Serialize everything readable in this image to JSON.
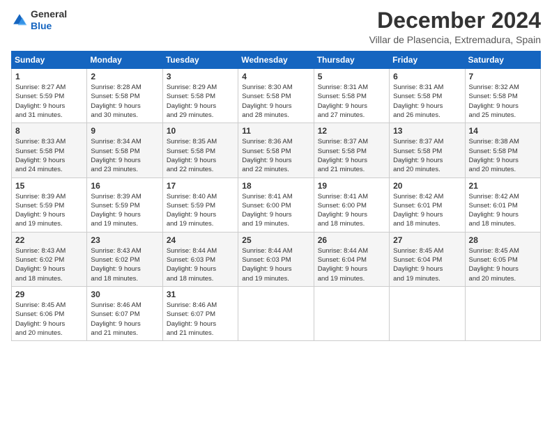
{
  "logo": {
    "line1": "General",
    "line2": "Blue"
  },
  "title": "December 2024",
  "subtitle": "Villar de Plasencia, Extremadura, Spain",
  "calendar": {
    "headers": [
      "Sunday",
      "Monday",
      "Tuesday",
      "Wednesday",
      "Thursday",
      "Friday",
      "Saturday"
    ],
    "weeks": [
      [
        {
          "day": "1",
          "info": "Sunrise: 8:27 AM\nSunset: 5:59 PM\nDaylight: 9 hours\nand 31 minutes."
        },
        {
          "day": "2",
          "info": "Sunrise: 8:28 AM\nSunset: 5:58 PM\nDaylight: 9 hours\nand 30 minutes."
        },
        {
          "day": "3",
          "info": "Sunrise: 8:29 AM\nSunset: 5:58 PM\nDaylight: 9 hours\nand 29 minutes."
        },
        {
          "day": "4",
          "info": "Sunrise: 8:30 AM\nSunset: 5:58 PM\nDaylight: 9 hours\nand 28 minutes."
        },
        {
          "day": "5",
          "info": "Sunrise: 8:31 AM\nSunset: 5:58 PM\nDaylight: 9 hours\nand 27 minutes."
        },
        {
          "day": "6",
          "info": "Sunrise: 8:31 AM\nSunset: 5:58 PM\nDaylight: 9 hours\nand 26 minutes."
        },
        {
          "day": "7",
          "info": "Sunrise: 8:32 AM\nSunset: 5:58 PM\nDaylight: 9 hours\nand 25 minutes."
        }
      ],
      [
        {
          "day": "8",
          "info": "Sunrise: 8:33 AM\nSunset: 5:58 PM\nDaylight: 9 hours\nand 24 minutes."
        },
        {
          "day": "9",
          "info": "Sunrise: 8:34 AM\nSunset: 5:58 PM\nDaylight: 9 hours\nand 23 minutes."
        },
        {
          "day": "10",
          "info": "Sunrise: 8:35 AM\nSunset: 5:58 PM\nDaylight: 9 hours\nand 22 minutes."
        },
        {
          "day": "11",
          "info": "Sunrise: 8:36 AM\nSunset: 5:58 PM\nDaylight: 9 hours\nand 22 minutes."
        },
        {
          "day": "12",
          "info": "Sunrise: 8:37 AM\nSunset: 5:58 PM\nDaylight: 9 hours\nand 21 minutes."
        },
        {
          "day": "13",
          "info": "Sunrise: 8:37 AM\nSunset: 5:58 PM\nDaylight: 9 hours\nand 20 minutes."
        },
        {
          "day": "14",
          "info": "Sunrise: 8:38 AM\nSunset: 5:58 PM\nDaylight: 9 hours\nand 20 minutes."
        }
      ],
      [
        {
          "day": "15",
          "info": "Sunrise: 8:39 AM\nSunset: 5:59 PM\nDaylight: 9 hours\nand 19 minutes."
        },
        {
          "day": "16",
          "info": "Sunrise: 8:39 AM\nSunset: 5:59 PM\nDaylight: 9 hours\nand 19 minutes."
        },
        {
          "day": "17",
          "info": "Sunrise: 8:40 AM\nSunset: 5:59 PM\nDaylight: 9 hours\nand 19 minutes."
        },
        {
          "day": "18",
          "info": "Sunrise: 8:41 AM\nSunset: 6:00 PM\nDaylight: 9 hours\nand 19 minutes."
        },
        {
          "day": "19",
          "info": "Sunrise: 8:41 AM\nSunset: 6:00 PM\nDaylight: 9 hours\nand 18 minutes."
        },
        {
          "day": "20",
          "info": "Sunrise: 8:42 AM\nSunset: 6:01 PM\nDaylight: 9 hours\nand 18 minutes."
        },
        {
          "day": "21",
          "info": "Sunrise: 8:42 AM\nSunset: 6:01 PM\nDaylight: 9 hours\nand 18 minutes."
        }
      ],
      [
        {
          "day": "22",
          "info": "Sunrise: 8:43 AM\nSunset: 6:02 PM\nDaylight: 9 hours\nand 18 minutes."
        },
        {
          "day": "23",
          "info": "Sunrise: 8:43 AM\nSunset: 6:02 PM\nDaylight: 9 hours\nand 18 minutes."
        },
        {
          "day": "24",
          "info": "Sunrise: 8:44 AM\nSunset: 6:03 PM\nDaylight: 9 hours\nand 18 minutes."
        },
        {
          "day": "25",
          "info": "Sunrise: 8:44 AM\nSunset: 6:03 PM\nDaylight: 9 hours\nand 19 minutes."
        },
        {
          "day": "26",
          "info": "Sunrise: 8:44 AM\nSunset: 6:04 PM\nDaylight: 9 hours\nand 19 minutes."
        },
        {
          "day": "27",
          "info": "Sunrise: 8:45 AM\nSunset: 6:04 PM\nDaylight: 9 hours\nand 19 minutes."
        },
        {
          "day": "28",
          "info": "Sunrise: 8:45 AM\nSunset: 6:05 PM\nDaylight: 9 hours\nand 20 minutes."
        }
      ],
      [
        {
          "day": "29",
          "info": "Sunrise: 8:45 AM\nSunset: 6:06 PM\nDaylight: 9 hours\nand 20 minutes."
        },
        {
          "day": "30",
          "info": "Sunrise: 8:46 AM\nSunset: 6:07 PM\nDaylight: 9 hours\nand 21 minutes."
        },
        {
          "day": "31",
          "info": "Sunrise: 8:46 AM\nSunset: 6:07 PM\nDaylight: 9 hours\nand 21 minutes."
        },
        null,
        null,
        null,
        null
      ]
    ]
  }
}
